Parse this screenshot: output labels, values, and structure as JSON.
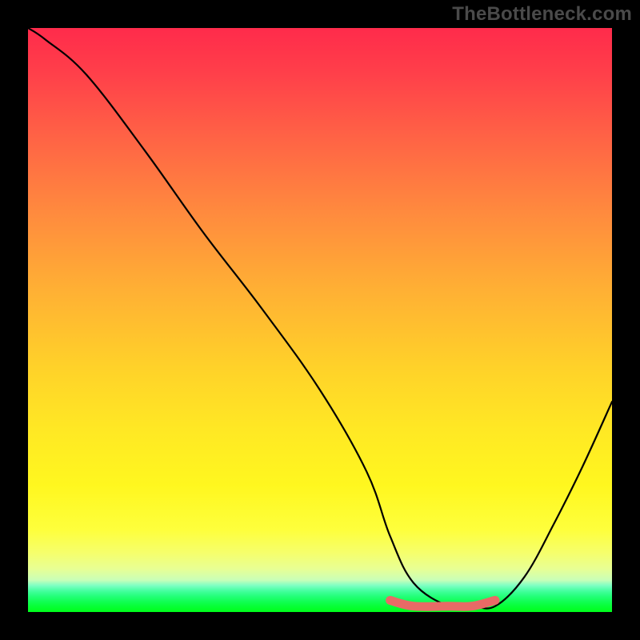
{
  "watermark": "TheBottleneck.com",
  "chart_data": {
    "type": "line",
    "title": "",
    "xlabel": "",
    "ylabel": "",
    "xlim": [
      0,
      100
    ],
    "ylim": [
      0,
      100
    ],
    "series": [
      {
        "name": "curve",
        "color": "#000000",
        "x": [
          0,
          3,
          10,
          20,
          30,
          40,
          50,
          58,
          62,
          66,
          72,
          76,
          80,
          85,
          90,
          95,
          100
        ],
        "values": [
          100,
          98,
          92,
          79,
          65,
          52,
          38,
          24,
          13,
          5,
          1,
          1,
          1,
          6,
          15,
          25,
          36
        ]
      },
      {
        "name": "highlight-band",
        "color": "#e86a66",
        "x": [
          62,
          66,
          72,
          76,
          80
        ],
        "values": [
          2,
          1,
          1,
          1,
          2
        ]
      }
    ],
    "gradient_stops": [
      {
        "pos": 0,
        "color": "#ff2b4b"
      },
      {
        "pos": 50,
        "color": "#ffd229"
      },
      {
        "pos": 90,
        "color": "#feff3c"
      },
      {
        "pos": 100,
        "color": "#00ff1a"
      }
    ]
  }
}
